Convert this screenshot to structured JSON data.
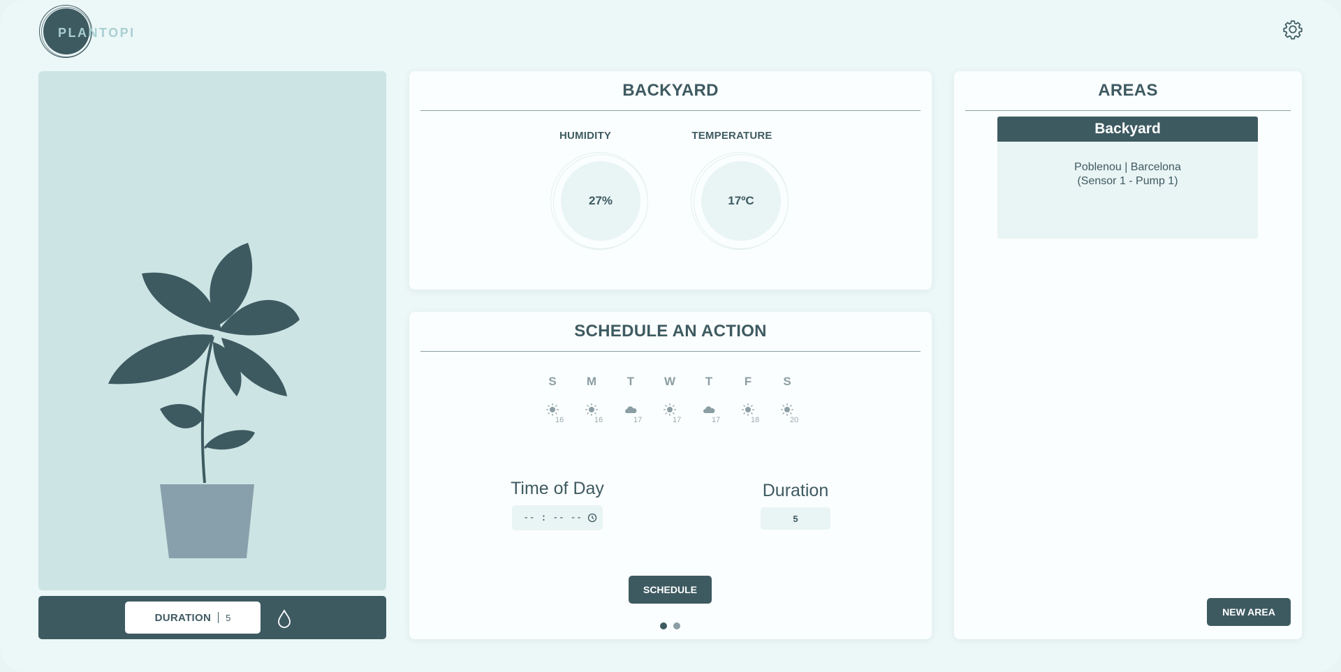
{
  "brand": {
    "name": "PLANTOPI"
  },
  "header": {
    "settings_icon": "gear-icon"
  },
  "plant_panel": {
    "duration_label": "DURATION",
    "duration_value": "5",
    "water_icon": "water-drop-icon"
  },
  "area_card": {
    "title": "BACKYARD",
    "humidity_label": "HUMIDITY",
    "humidity_value": "27%",
    "temperature_label": "TEMPERATURE",
    "temperature_value": "17ºC"
  },
  "schedule_card": {
    "title": "SCHEDULE AN ACTION",
    "forecast": [
      {
        "day": "S",
        "icon": "sun-icon",
        "temp": "16"
      },
      {
        "day": "M",
        "icon": "sun-icon",
        "temp": "16"
      },
      {
        "day": "T",
        "icon": "cloud-icon",
        "temp": "17"
      },
      {
        "day": "W",
        "icon": "sun-icon",
        "temp": "17"
      },
      {
        "day": "T",
        "icon": "cloud-icon",
        "temp": "17"
      },
      {
        "day": "F",
        "icon": "sun-icon",
        "temp": "18"
      },
      {
        "day": "S",
        "icon": "sun-icon",
        "temp": "20"
      }
    ],
    "time_of_day_label": "Time of Day",
    "time_value": "-- : --  --",
    "duration_label": "Duration",
    "duration_value": "5",
    "schedule_button": "SCHEDULE",
    "pagination": {
      "pages": 2,
      "current": 1
    }
  },
  "areas_card": {
    "title": "AREAS",
    "items": [
      {
        "name": "Backyard",
        "location": "Poblenou | Barcelona",
        "sensor": "(Sensor 1 - Pump 1)"
      }
    ],
    "new_area_button": "NEW AREA"
  },
  "colors": {
    "primary": "#3e5a61",
    "background": "#ecf7f7",
    "panel": "#cde4e4",
    "light": "#e9f4f4",
    "pot": "#87a0ab",
    "muted": "#8a9ea3"
  }
}
